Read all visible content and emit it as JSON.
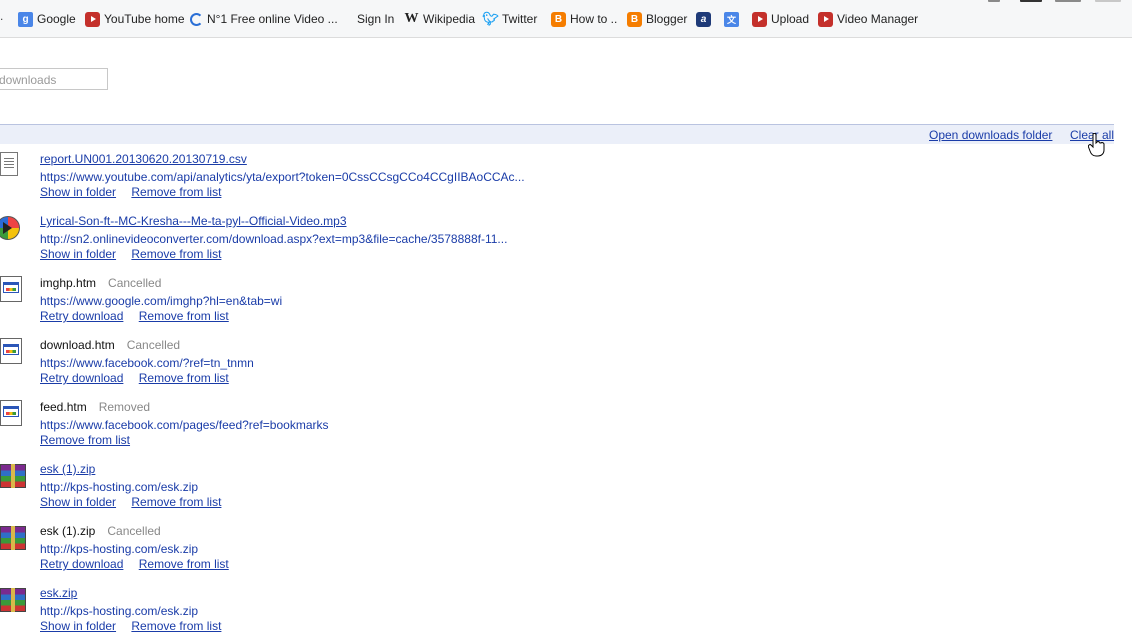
{
  "bookmarks": [
    {
      "label": "Google",
      "icon": "google-icon"
    },
    {
      "label": "YouTube home",
      "icon": "youtube-icon"
    },
    {
      "label": "N°1 Free online Video ...",
      "icon": "converter-icon"
    },
    {
      "label": "Sign In",
      "icon": "microsoft-icon"
    },
    {
      "label": "Wikipedia",
      "icon": "wikipedia-icon"
    },
    {
      "label": "Twitter",
      "icon": "twitter-icon"
    },
    {
      "label": "How to ..",
      "icon": "blogger-icon"
    },
    {
      "label": "Blogger",
      "icon": "blogger-icon"
    },
    {
      "label": "",
      "icon": "a-icon"
    },
    {
      "label": "",
      "icon": "translate-icon"
    },
    {
      "label": "Upload",
      "icon": "youtube-icon"
    },
    {
      "label": "Video Manager",
      "icon": "youtube-icon"
    }
  ],
  "search": {
    "placeholder": "downloads"
  },
  "summary": {
    "open_folder": "Open downloads folder",
    "clear_all": "Clear all"
  },
  "downloads": [
    {
      "name": "report.UN001.20130620.20130719.csv",
      "status": "",
      "url": "https://www.youtube.com/api/analytics/yta/export?token=0CssCCsgCCo4CCgIIBAoCCAc...",
      "actions": [
        "Show in folder",
        "Remove from list"
      ],
      "icon": "csv-file-icon"
    },
    {
      "name": "Lyrical-Son-ft--MC-Kresha---Me-ta-pyl--Official-Video.mp3",
      "status": "",
      "url": "http://sn2.onlinevideoconverter.com/download.aspx?ext=mp3&file=cache/3578888f-11...",
      "actions": [
        "Show in folder",
        "Remove from list"
      ],
      "icon": "mp3-file-icon"
    },
    {
      "name": "imghp.htm",
      "status": "Cancelled",
      "url": "https://www.google.com/imghp?hl=en&tab=wi",
      "actions": [
        "Retry download",
        "Remove from list"
      ],
      "icon": "htm-file-icon"
    },
    {
      "name": "download.htm",
      "status": "Cancelled",
      "url": "https://www.facebook.com/?ref=tn_tnmn",
      "actions": [
        "Retry download",
        "Remove from list"
      ],
      "icon": "htm-file-icon"
    },
    {
      "name": "feed.htm",
      "status": "Removed",
      "url": "https://www.facebook.com/pages/feed?ref=bookmarks",
      "actions": [
        "Remove from list"
      ],
      "icon": "htm-file-icon"
    },
    {
      "name": "esk (1).zip",
      "status": "",
      "url": "http://kps-hosting.com/esk.zip",
      "actions": [
        "Show in folder",
        "Remove from list"
      ],
      "icon": "zip-file-icon"
    },
    {
      "name": "esk (1).zip",
      "status": "Cancelled",
      "url": "http://kps-hosting.com/esk.zip",
      "actions": [
        "Retry download",
        "Remove from list"
      ],
      "icon": "zip-file-icon"
    },
    {
      "name": "esk.zip",
      "status": "",
      "url": "http://kps-hosting.com/esk.zip",
      "actions": [
        "Show in folder",
        "Remove from list"
      ],
      "icon": "zip-file-icon"
    }
  ]
}
